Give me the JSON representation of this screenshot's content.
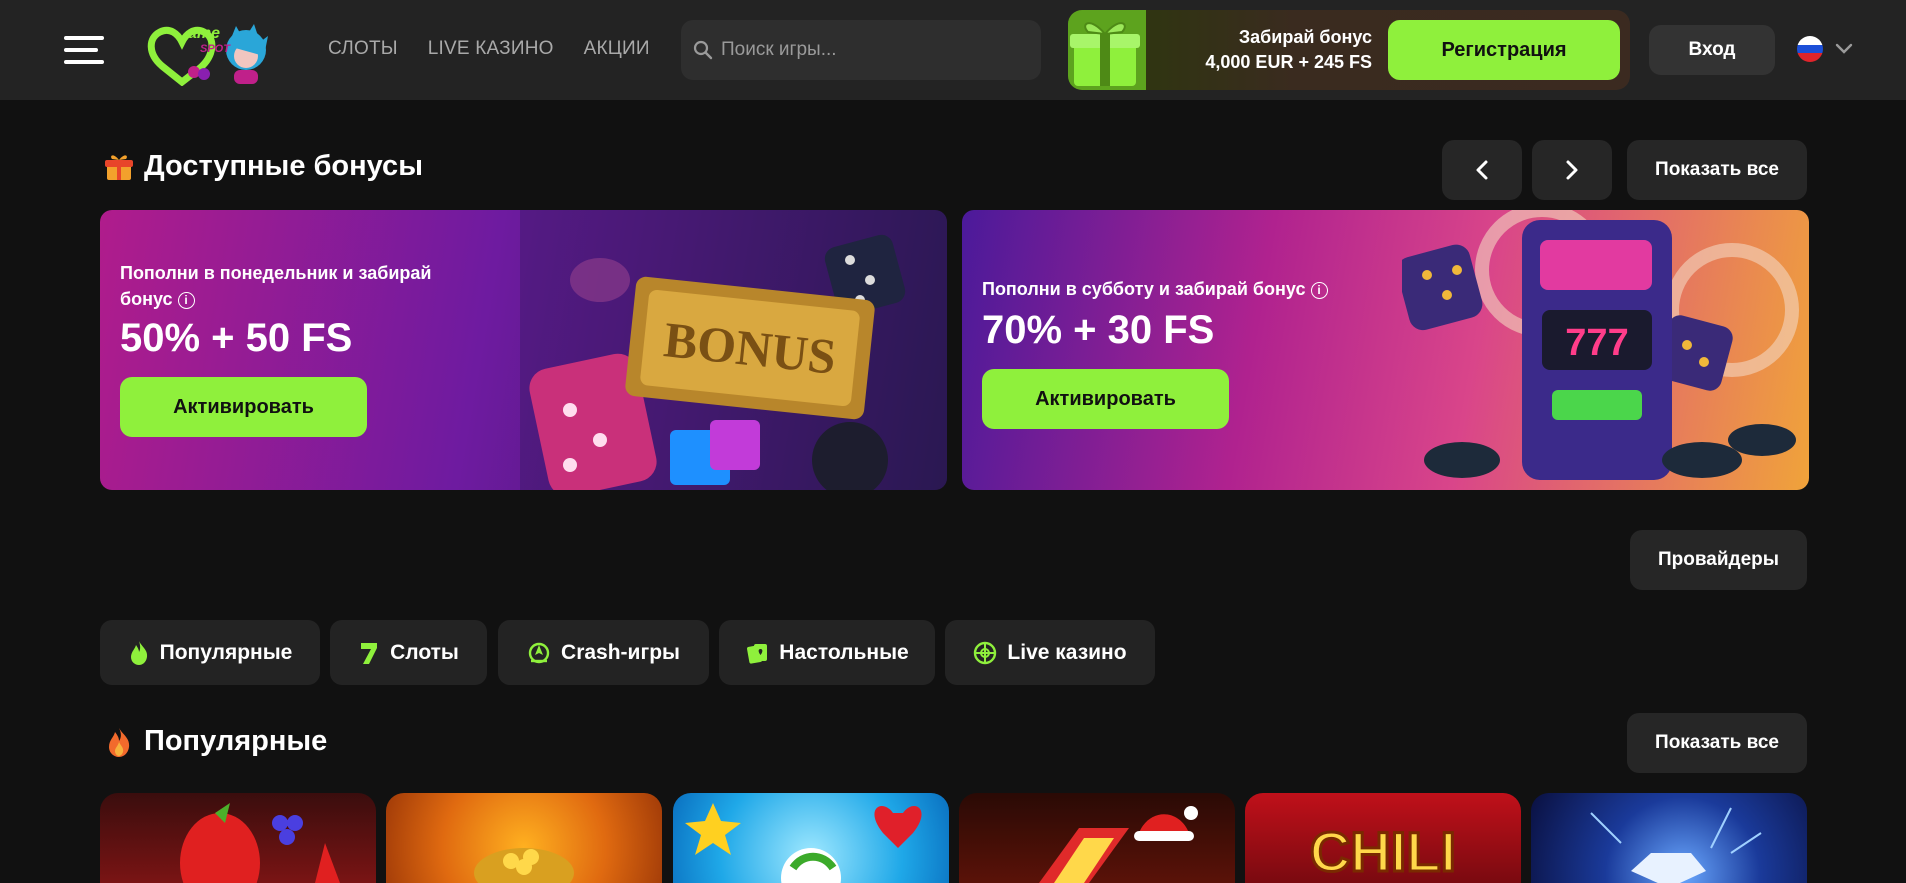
{
  "header": {
    "nav": [
      "СЛОТЫ",
      "LIVE КАЗИНО",
      "АКЦИИ"
    ],
    "search_placeholder": "Поиск игры...",
    "promo_line1": "Забирай бонус",
    "promo_line2": "4,000 EUR + 245 FS",
    "register_label": "Регистрация",
    "login_label": "Вход",
    "language": "RU"
  },
  "bonuses": {
    "title": "Доступные бонусы",
    "show_all": "Показать все",
    "cards": [
      {
        "subtitle_l1": "Пополни в понедельник и забирай",
        "subtitle_l2": "бонус",
        "amount": "50% + 50 FS",
        "button": "Активировать",
        "art_text": "BONUS"
      },
      {
        "subtitle_l1": "Пополни в субботу и забирай бонус",
        "amount": "70% + 30 FS",
        "button": "Активировать",
        "art_text": "777"
      }
    ]
  },
  "providers_label": "Провайдеры",
  "categories": [
    "Популярные",
    "Слоты",
    "Crash-игры",
    "Настольные",
    "Live казино"
  ],
  "popular": {
    "title": "Популярные",
    "show_all": "Показать все",
    "game_art_text": "CHILI"
  },
  "colors": {
    "accent": "#8ff03c",
    "background": "#111111",
    "header": "#232323"
  }
}
